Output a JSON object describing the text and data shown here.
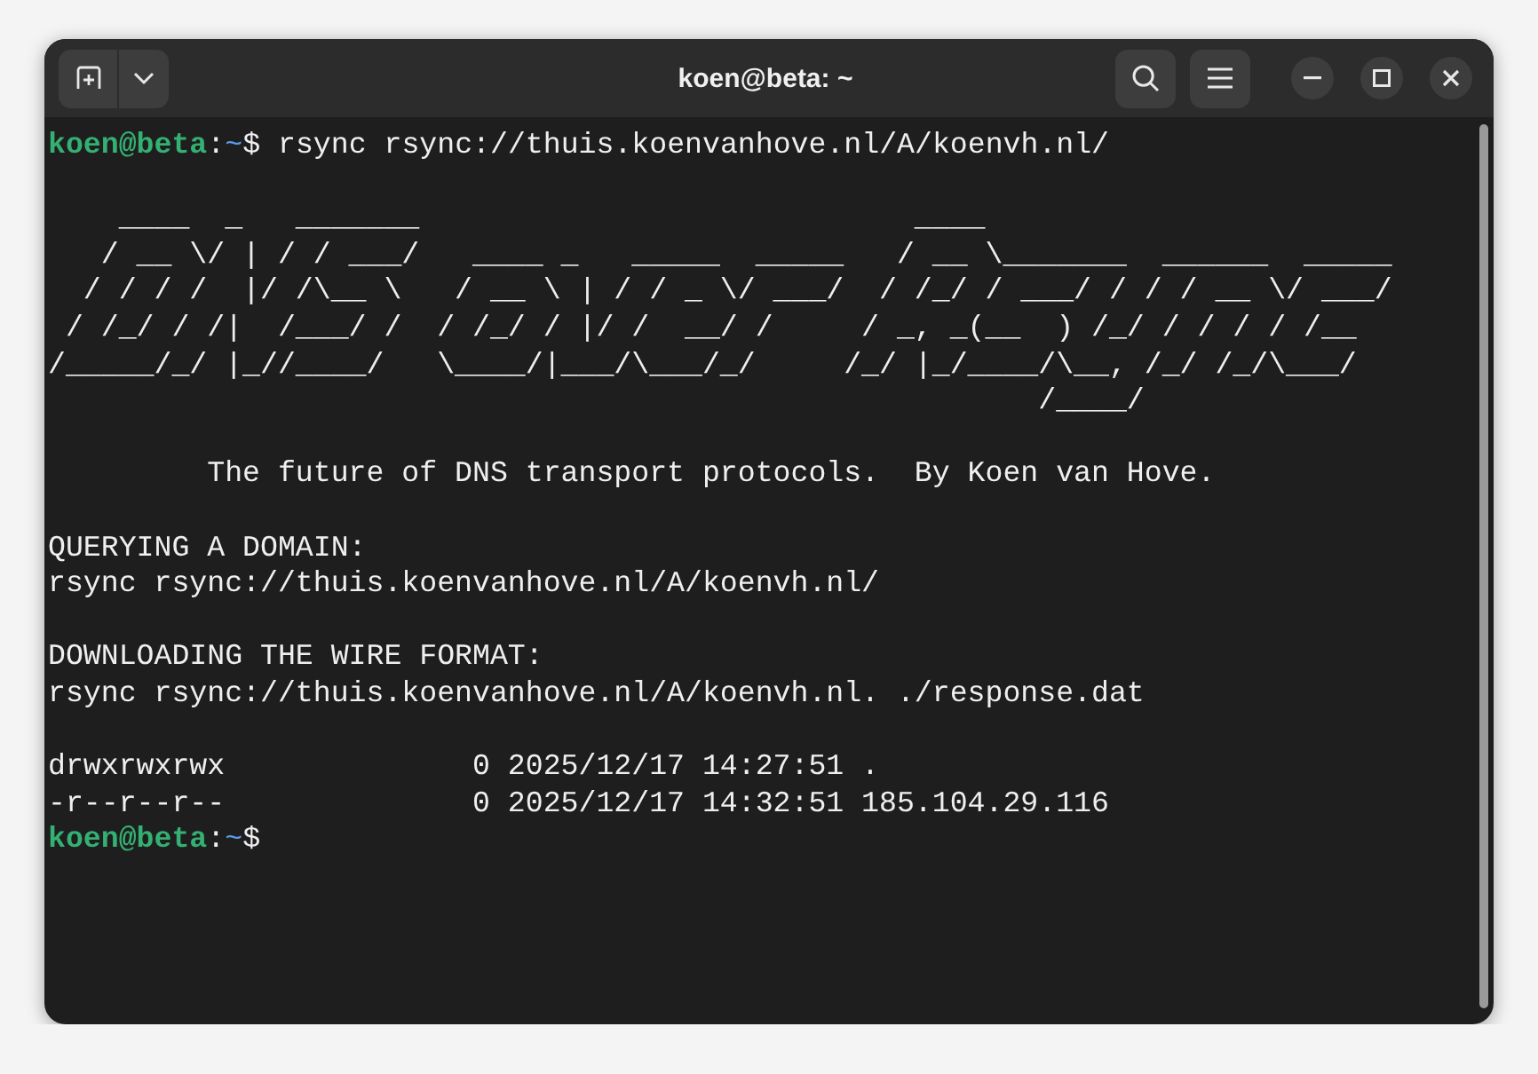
{
  "window": {
    "title": "koen@beta: ~"
  },
  "terminal": {
    "lines": [
      {
        "kind": "prompt",
        "user": "koen@beta",
        "separator": ":",
        "path": "~",
        "symbol": "$",
        "command": "rsync rsync://thuis.koenvanhove.nl/A/koenvh.nl/"
      },
      {
        "kind": "blank"
      },
      {
        "kind": "text",
        "text": "    ____  _   _______                            ____"
      },
      {
        "kind": "text",
        "text": "   / __ \\/ | / / ___/   ____ _   _____  _____   / __ \\_______  ______  _____"
      },
      {
        "kind": "text",
        "text": "  / / / /  |/ /\\__ \\   / __ \\ | / / _ \\/ ___/  / /_/ / ___/ / / / __ \\/ ___/"
      },
      {
        "kind": "text",
        "text": " / /_/ / /|  /___/ /  / /_/ / |/ /  __/ /     / _, _(__  ) /_/ / / / / /__"
      },
      {
        "kind": "text",
        "text": "/_____/_/ |_//____/   \\____/|___/\\___/_/     /_/ |_/____/\\__, /_/ /_/\\___/"
      },
      {
        "kind": "text",
        "text": "                                                        /____/"
      },
      {
        "kind": "blank"
      },
      {
        "kind": "text",
        "text": "         The future of DNS transport protocols.  By Koen van Hove."
      },
      {
        "kind": "blank"
      },
      {
        "kind": "text",
        "text": "QUERYING A DOMAIN:"
      },
      {
        "kind": "text",
        "text": "rsync rsync://thuis.koenvanhove.nl/A/koenvh.nl/"
      },
      {
        "kind": "blank"
      },
      {
        "kind": "text",
        "text": "DOWNLOADING THE WIRE FORMAT:"
      },
      {
        "kind": "text",
        "text": "rsync rsync://thuis.koenvanhove.nl/A/koenvh.nl. ./response.dat"
      },
      {
        "kind": "blank"
      },
      {
        "kind": "text",
        "text": "drwxrwxrwx              0 2025/12/17 14:27:51 ."
      },
      {
        "kind": "text",
        "text": "-r--r--r--              0 2025/12/17 14:32:51 185.104.29.116"
      },
      {
        "kind": "prompt",
        "user": "koen@beta",
        "separator": ":",
        "path": "~",
        "symbol": "$"
      }
    ]
  }
}
